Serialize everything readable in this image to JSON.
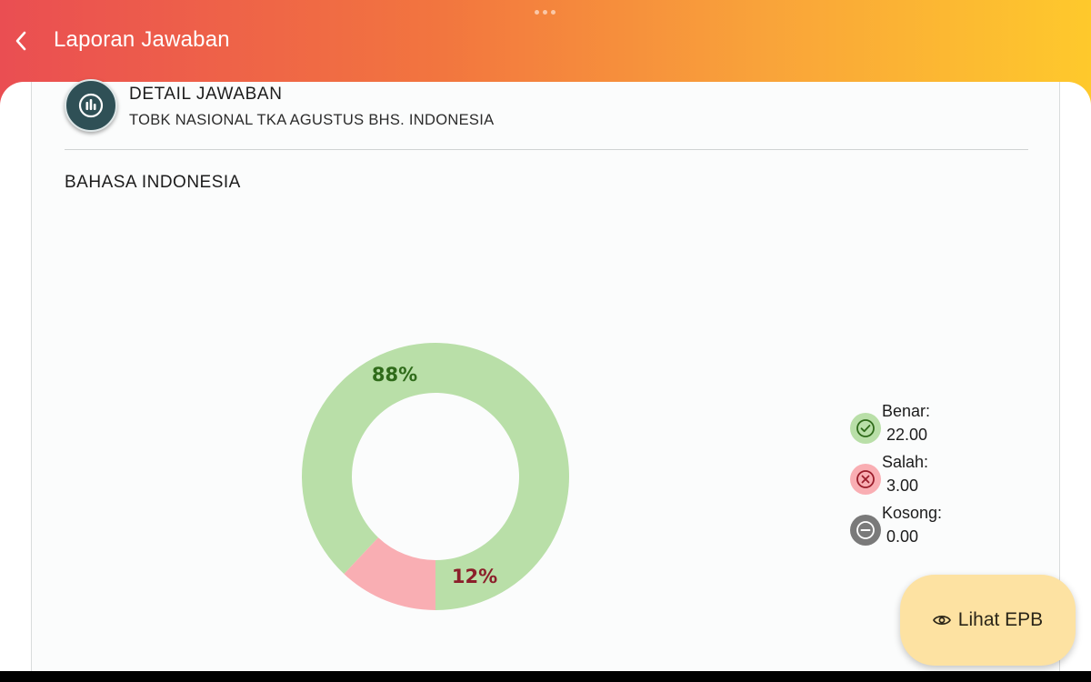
{
  "header": {
    "title": "Laporan Jawaban",
    "back_icon": "chevron-left-icon"
  },
  "card": {
    "icon": "bar-chart-icon",
    "title": "DETAIL JAWABAN",
    "subtitle": "TOBK NASIONAL TKA AGUSTUS BHS. INDONESIA",
    "section_title": "BAHASA INDONESIA"
  },
  "chart_data": {
    "type": "pie",
    "style": "donut",
    "categories": [
      "Benar",
      "Salah",
      "Kosong"
    ],
    "values": [
      88,
      12,
      0
    ],
    "labels": [
      "88%",
      "12%",
      ""
    ],
    "colors": [
      "#b9dfa8",
      "#f9aeb3",
      "#7a7a7a"
    ],
    "label_colors": [
      "#2f6b1a",
      "#8b1f2a",
      "#333333"
    ]
  },
  "legend": [
    {
      "label": "Benar:",
      "value": "22.00",
      "icon": "check-circle-icon",
      "bg": "#b9dfa8",
      "fg": "#2f6b1a"
    },
    {
      "label": "Salah:",
      "value": "3.00",
      "icon": "x-circle-icon",
      "bg": "#f9aeb3",
      "fg": "#9b1d2b"
    },
    {
      "label": "Kosong:",
      "value": "0.00",
      "icon": "minus-circle-icon",
      "bg": "#7a7a7a",
      "fg": "#ffffff"
    }
  ],
  "actions": {
    "epb_label": "Lihat EPB",
    "epb_icon": "eye-icon"
  }
}
